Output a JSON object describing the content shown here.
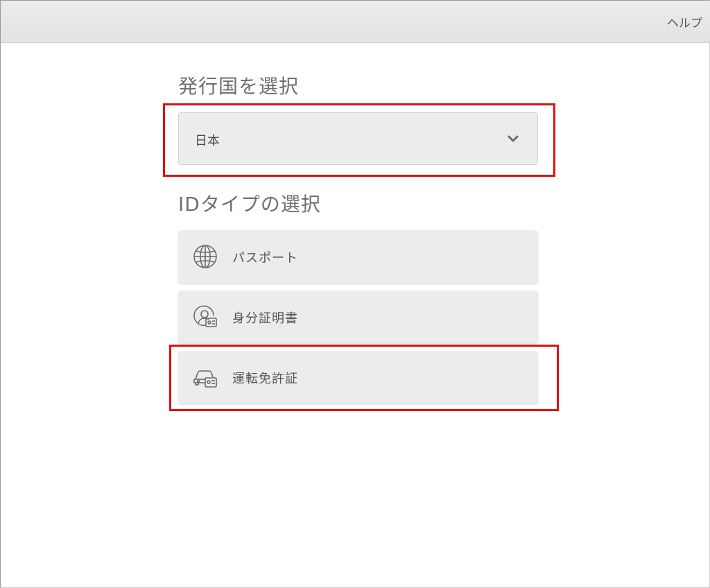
{
  "header": {
    "help_label": "ヘルプ"
  },
  "country_section": {
    "title": "発行国を選択",
    "selected_value": "日本"
  },
  "id_type_section": {
    "title": "IDタイプの選択",
    "options": [
      {
        "label": "パスポート",
        "icon": "globe-icon"
      },
      {
        "label": "身分証明書",
        "icon": "id-card-icon"
      },
      {
        "label": "運転免許証",
        "icon": "car-license-icon"
      }
    ]
  },
  "colors": {
    "highlight": "#e01010",
    "option_background": "#ececec",
    "text": "#555555"
  }
}
